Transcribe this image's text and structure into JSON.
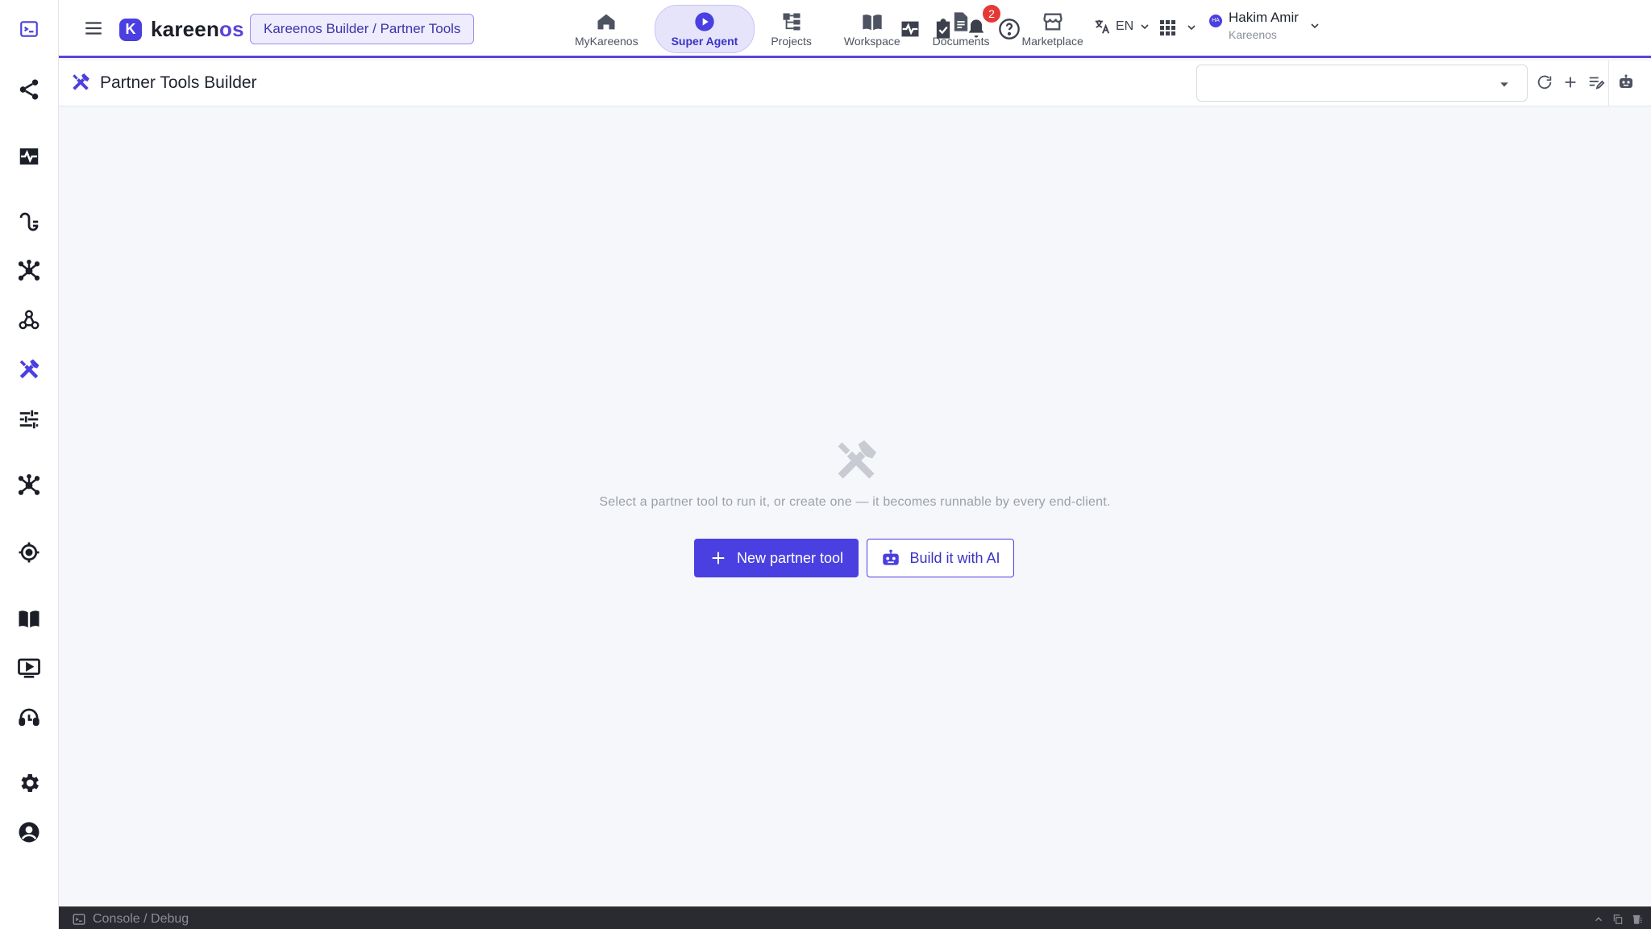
{
  "app": {
    "brand_initial": "K",
    "brand_name_main": "kareen",
    "brand_name_accent": "os",
    "breadcrumb": "Kareenos Builder / Partner Tools",
    "accent_color": "#4a3fe0"
  },
  "nav": {
    "tabs": [
      {
        "label": "MyKareenos",
        "icon": "home-icon"
      },
      {
        "label": "Super Agent",
        "icon": "play-circle-icon",
        "active": true
      },
      {
        "label": "Projects",
        "icon": "hierarchy-icon"
      },
      {
        "label": "Workspace",
        "icon": "book-open-icon"
      },
      {
        "label": "Documents",
        "icon": "document-icon"
      },
      {
        "label": "Marketplace",
        "icon": "store-icon"
      }
    ]
  },
  "header": {
    "notification_count": "2",
    "language": "EN",
    "user_name": "Hakim Amir",
    "user_org": "Kareenos",
    "avatar_initials": "HA"
  },
  "sidebar": {
    "items": [
      {
        "name": "console-icon"
      },
      {
        "name": "share-icon"
      },
      {
        "name": "activity-monitor-icon"
      },
      {
        "name": "plug-icon"
      },
      {
        "name": "hub-network-icon"
      },
      {
        "name": "webhook-icon"
      },
      {
        "name": "tools-icon",
        "active": true
      },
      {
        "name": "sliders-icon"
      },
      {
        "name": "network-icon"
      },
      {
        "name": "target-icon"
      },
      {
        "name": "book-icon"
      },
      {
        "name": "video-icon"
      },
      {
        "name": "headset-icon"
      },
      {
        "name": "settings-icon"
      },
      {
        "name": "account-icon"
      }
    ]
  },
  "page": {
    "title": "Partner Tools Builder",
    "select_value": ""
  },
  "empty_state": {
    "message": "Select a partner tool to run it, or create one — it becomes runnable by every end-client.",
    "primary_button": "New partner tool",
    "secondary_button": "Build it with AI"
  },
  "console": {
    "label": "Console / Debug"
  }
}
